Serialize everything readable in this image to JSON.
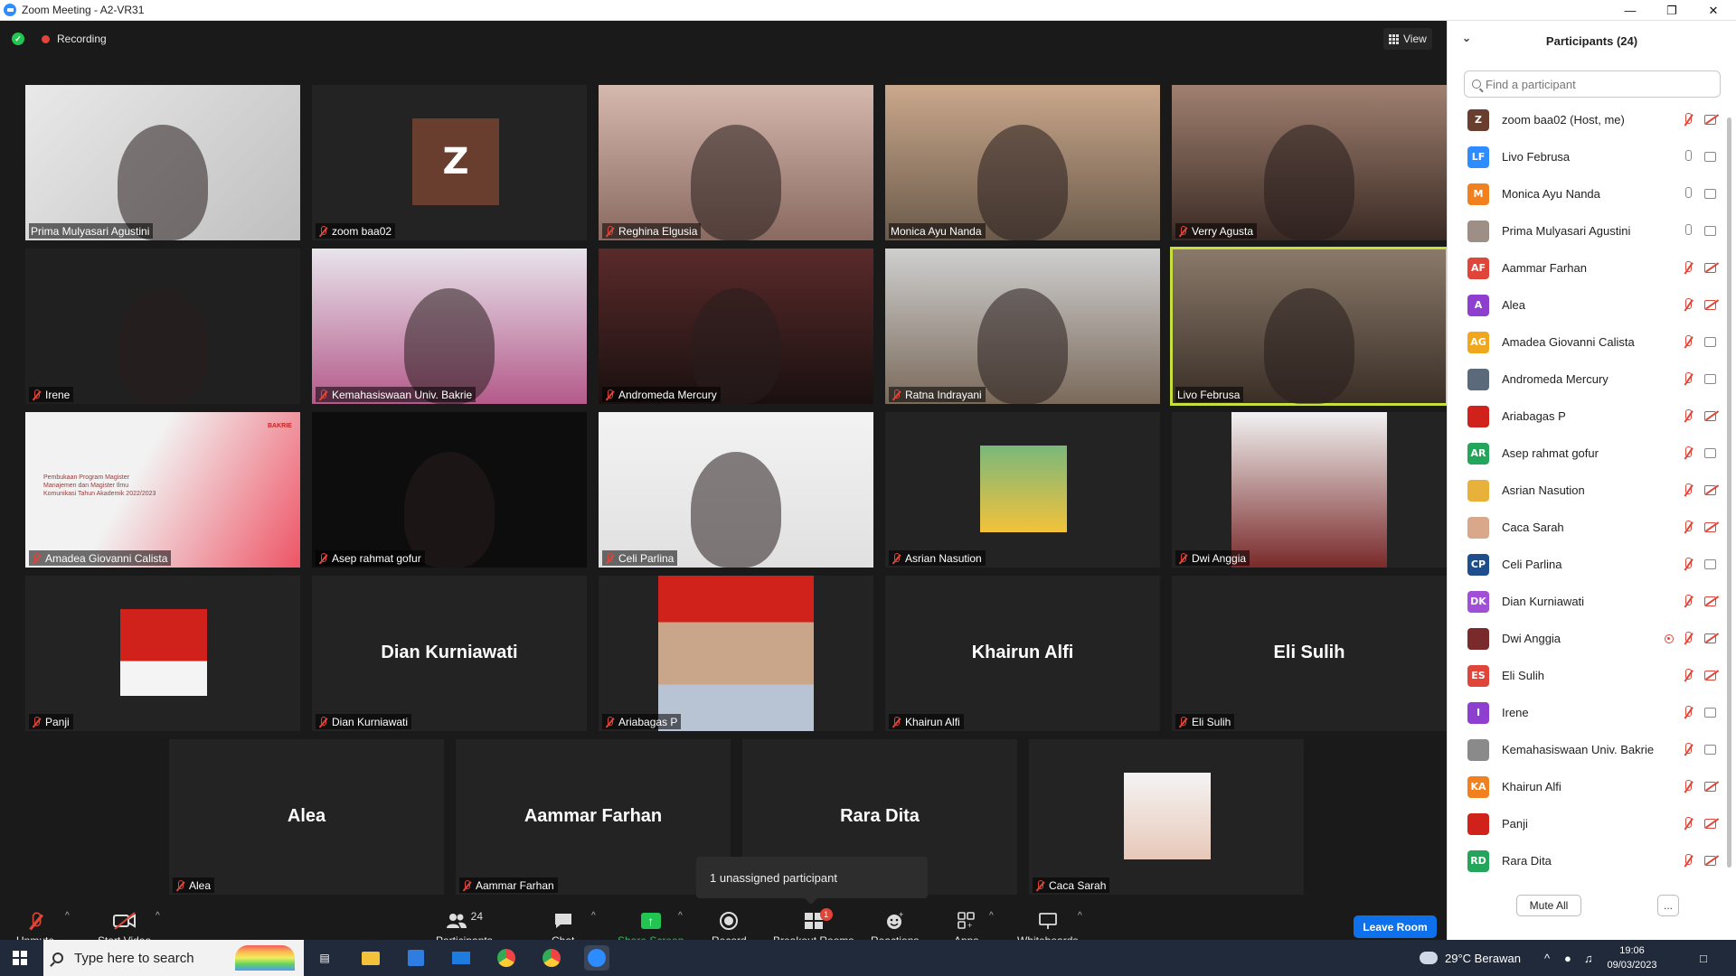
{
  "window": {
    "title": "Zoom Meeting - A2-VR31"
  },
  "topbar": {
    "recording_label": "Recording",
    "view_label": "View"
  },
  "tiles": [
    {
      "name": "Prima Mulyasari Agustini",
      "muted": false,
      "type": "video"
    },
    {
      "name": "zoom baa02",
      "muted": true,
      "type": "avatar",
      "initial": "Z"
    },
    {
      "name": "Reghina Elgusia",
      "muted": true,
      "type": "video"
    },
    {
      "name": "Monica Ayu Nanda",
      "muted": false,
      "type": "video"
    },
    {
      "name": "Verry Agusta",
      "muted": true,
      "type": "video"
    },
    {
      "name": "Irene",
      "muted": true,
      "type": "video"
    },
    {
      "name": "Kemahasiswaan Univ. Bakrie",
      "muted": true,
      "type": "video"
    },
    {
      "name": "Andromeda Mercury",
      "muted": true,
      "type": "video"
    },
    {
      "name": "Ratna Indrayani",
      "muted": true,
      "type": "video"
    },
    {
      "name": "Livo Februsa",
      "muted": false,
      "type": "video",
      "active": true
    },
    {
      "name": "Amadea Giovanni Calista",
      "muted": true,
      "type": "slide",
      "slide_text": "Pembukaan Program Magister Manajemen dan Magister Ilmu Komunikasi Tahun Akademik 2022/2023",
      "slide_logo": "BAKRIE"
    },
    {
      "name": "Asep rahmat gofur",
      "muted": true,
      "type": "video"
    },
    {
      "name": "Celi Parlina",
      "muted": true,
      "type": "video"
    },
    {
      "name": "Asrian Nasution",
      "muted": true,
      "type": "photo"
    },
    {
      "name": "Dwi Anggia",
      "muted": true,
      "type": "photo"
    },
    {
      "name": "Panji",
      "muted": true,
      "type": "photo"
    },
    {
      "name": "Dian Kurniawati",
      "muted": true,
      "type": "name",
      "big": "Dian Kurniawati"
    },
    {
      "name": "Ariabagas P",
      "muted": true,
      "type": "photo"
    },
    {
      "name": "Khairun Alfi",
      "muted": true,
      "type": "name",
      "big": "Khairun Alfi"
    },
    {
      "name": "Eli Sulih",
      "muted": true,
      "type": "name",
      "big": "Eli Sulih"
    },
    {
      "name": "Alea",
      "muted": true,
      "type": "name",
      "big": "Alea"
    },
    {
      "name": "Aammar Farhan",
      "muted": true,
      "type": "name",
      "big": "Aammar Farhan"
    },
    {
      "name": "Rara Dita",
      "muted": true,
      "type": "name",
      "big": "Rara Dita"
    },
    {
      "name": "Caca Sarah",
      "muted": true,
      "type": "photo"
    }
  ],
  "popup": {
    "text": "1 unassigned participant"
  },
  "toolbar": {
    "unmute": "Unmute",
    "start_video": "Start Video",
    "participants": "Participants",
    "participants_count": "24",
    "chat": "Chat",
    "share_screen": "Share Screen",
    "record": "Record",
    "breakout_rooms": "Breakout Rooms",
    "breakout_badge": "1",
    "reactions": "Reactions",
    "apps": "Apps",
    "whiteboards": "Whiteboards",
    "leave_room": "Leave Room"
  },
  "panel": {
    "title": "Participants (24)",
    "search_placeholder": "Find a participant",
    "mute_all": "Mute All",
    "more": "...",
    "participants": [
      {
        "name": "zoom baa02 (Host, me)",
        "initials": "Z",
        "color": "#6a3e2e",
        "mic": "muted",
        "cam": "off"
      },
      {
        "name": "Livo Februsa",
        "initials": "LF",
        "color": "#2d8cff",
        "mic": "on",
        "cam": "on"
      },
      {
        "name": "Monica Ayu Nanda",
        "initials": "M",
        "color": "#f0811e",
        "mic": "on",
        "cam": "on"
      },
      {
        "name": "Prima Mulyasari Agustini",
        "initials": "",
        "color": "#9e8f86",
        "mic": "on",
        "cam": "on"
      },
      {
        "name": "Aammar Farhan",
        "initials": "AF",
        "color": "#e0453a",
        "mic": "muted",
        "cam": "off"
      },
      {
        "name": "Alea",
        "initials": "A",
        "color": "#8f3fcf",
        "mic": "muted",
        "cam": "off"
      },
      {
        "name": "Amadea Giovanni Calista",
        "initials": "AG",
        "color": "#f0a71e",
        "mic": "muted",
        "cam": "on"
      },
      {
        "name": "Andromeda Mercury",
        "initials": "",
        "color": "#5a6a7a",
        "mic": "muted",
        "cam": "on"
      },
      {
        "name": "Ariabagas P",
        "initials": "",
        "color": "#d0221a",
        "mic": "muted",
        "cam": "off"
      },
      {
        "name": "Asep rahmat gofur",
        "initials": "AR",
        "color": "#23a55a",
        "mic": "muted",
        "cam": "on"
      },
      {
        "name": "Asrian Nasution",
        "initials": "",
        "color": "#e8b23a",
        "mic": "muted",
        "cam": "off"
      },
      {
        "name": "Caca Sarah",
        "initials": "",
        "color": "#d9a88a",
        "mic": "muted",
        "cam": "off"
      },
      {
        "name": "Celi Parlina",
        "initials": "CP",
        "color": "#1e4e8c",
        "mic": "muted",
        "cam": "on"
      },
      {
        "name": "Dian Kurniawati",
        "initials": "DK",
        "color": "#a04fd6",
        "mic": "muted",
        "cam": "off"
      },
      {
        "name": "Dwi Anggia",
        "initials": "",
        "color": "#7a2a2a",
        "mic": "muted",
        "cam": "off",
        "recording": true
      },
      {
        "name": "Eli Sulih",
        "initials": "ES",
        "color": "#e0453a",
        "mic": "muted",
        "cam": "off"
      },
      {
        "name": "Irene",
        "initials": "I",
        "color": "#8f3fcf",
        "mic": "muted",
        "cam": "on"
      },
      {
        "name": "Kemahasiswaan Univ. Bakrie",
        "initials": "",
        "color": "#8a8a8a",
        "mic": "muted",
        "cam": "on"
      },
      {
        "name": "Khairun Alfi",
        "initials": "KA",
        "color": "#f0811e",
        "mic": "muted",
        "cam": "off"
      },
      {
        "name": "Panji",
        "initials": "",
        "color": "#d0221a",
        "mic": "muted",
        "cam": "off"
      },
      {
        "name": "Rara Dita",
        "initials": "RD",
        "color": "#23a55a",
        "mic": "muted",
        "cam": "off"
      }
    ]
  },
  "taskbar": {
    "search_placeholder": "Type here to search",
    "weather": "29°C  Berawan",
    "time": "19:06",
    "date": "09/03/2023"
  }
}
